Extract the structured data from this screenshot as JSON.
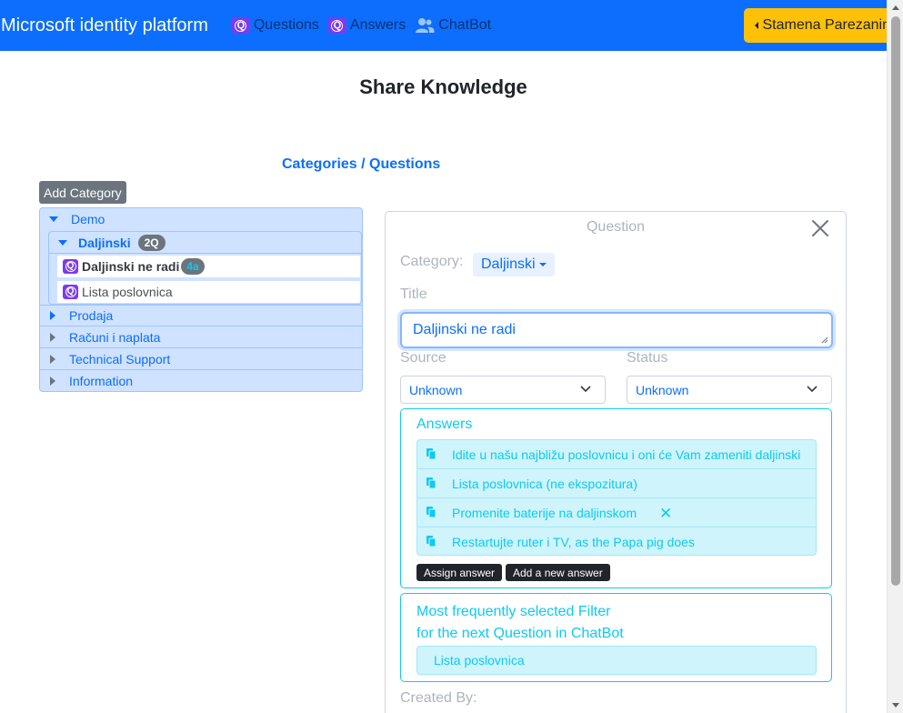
{
  "navbar": {
    "brand": "Microsoft identity platform",
    "links": [
      {
        "label": "Questions",
        "icon": "question-badge-icon"
      },
      {
        "label": "Answers",
        "icon": "question-badge-icon"
      },
      {
        "label": "ChatBot",
        "icon": "users-icon"
      }
    ],
    "user_button": "Stamena Parezanin",
    "colors": {
      "bar": "#0d6efd",
      "user": "#ffc107"
    }
  },
  "page": {
    "title": "Share Knowledge",
    "subtitle": "Categories / Questions",
    "add_category": "Add Category"
  },
  "tree": {
    "demo": "Demo",
    "daljinski": "Daljinski",
    "daljinski_badge": "2Q",
    "questions": [
      {
        "label": "Daljinski ne radi",
        "badge": "4a"
      },
      {
        "label": "Lista poslovnica"
      }
    ],
    "categories": [
      "Prodaja",
      "Računi i naplata",
      "Technical Support",
      "Information"
    ]
  },
  "question": {
    "header": "Question",
    "category_label": "Category:",
    "category_value": "Daljinski",
    "title_label": "Title",
    "title_value": "Daljinski ne radi",
    "source_label": "Source",
    "source_value": "Unknown",
    "status_label": "Status",
    "status_value": "Unknown",
    "answers_title": "Answers",
    "answers": [
      "Idite u našu najbližu poslovnicu i oni će Vam zameniti daljinski",
      "Lista poslovnica (ne ekspozitura)",
      "Promenite baterije na daljinskom",
      "Restartujte ruter i TV, as the Papa pig does"
    ],
    "assign_answer": "Assign answer",
    "add_answer": "Add a new answer",
    "filter_title_1": "Most frequently selected Filter",
    "filter_title_2": "for the next Question in ChatBot",
    "filter_item": "Lista poslovnica",
    "created_by_label": "Created By:"
  }
}
